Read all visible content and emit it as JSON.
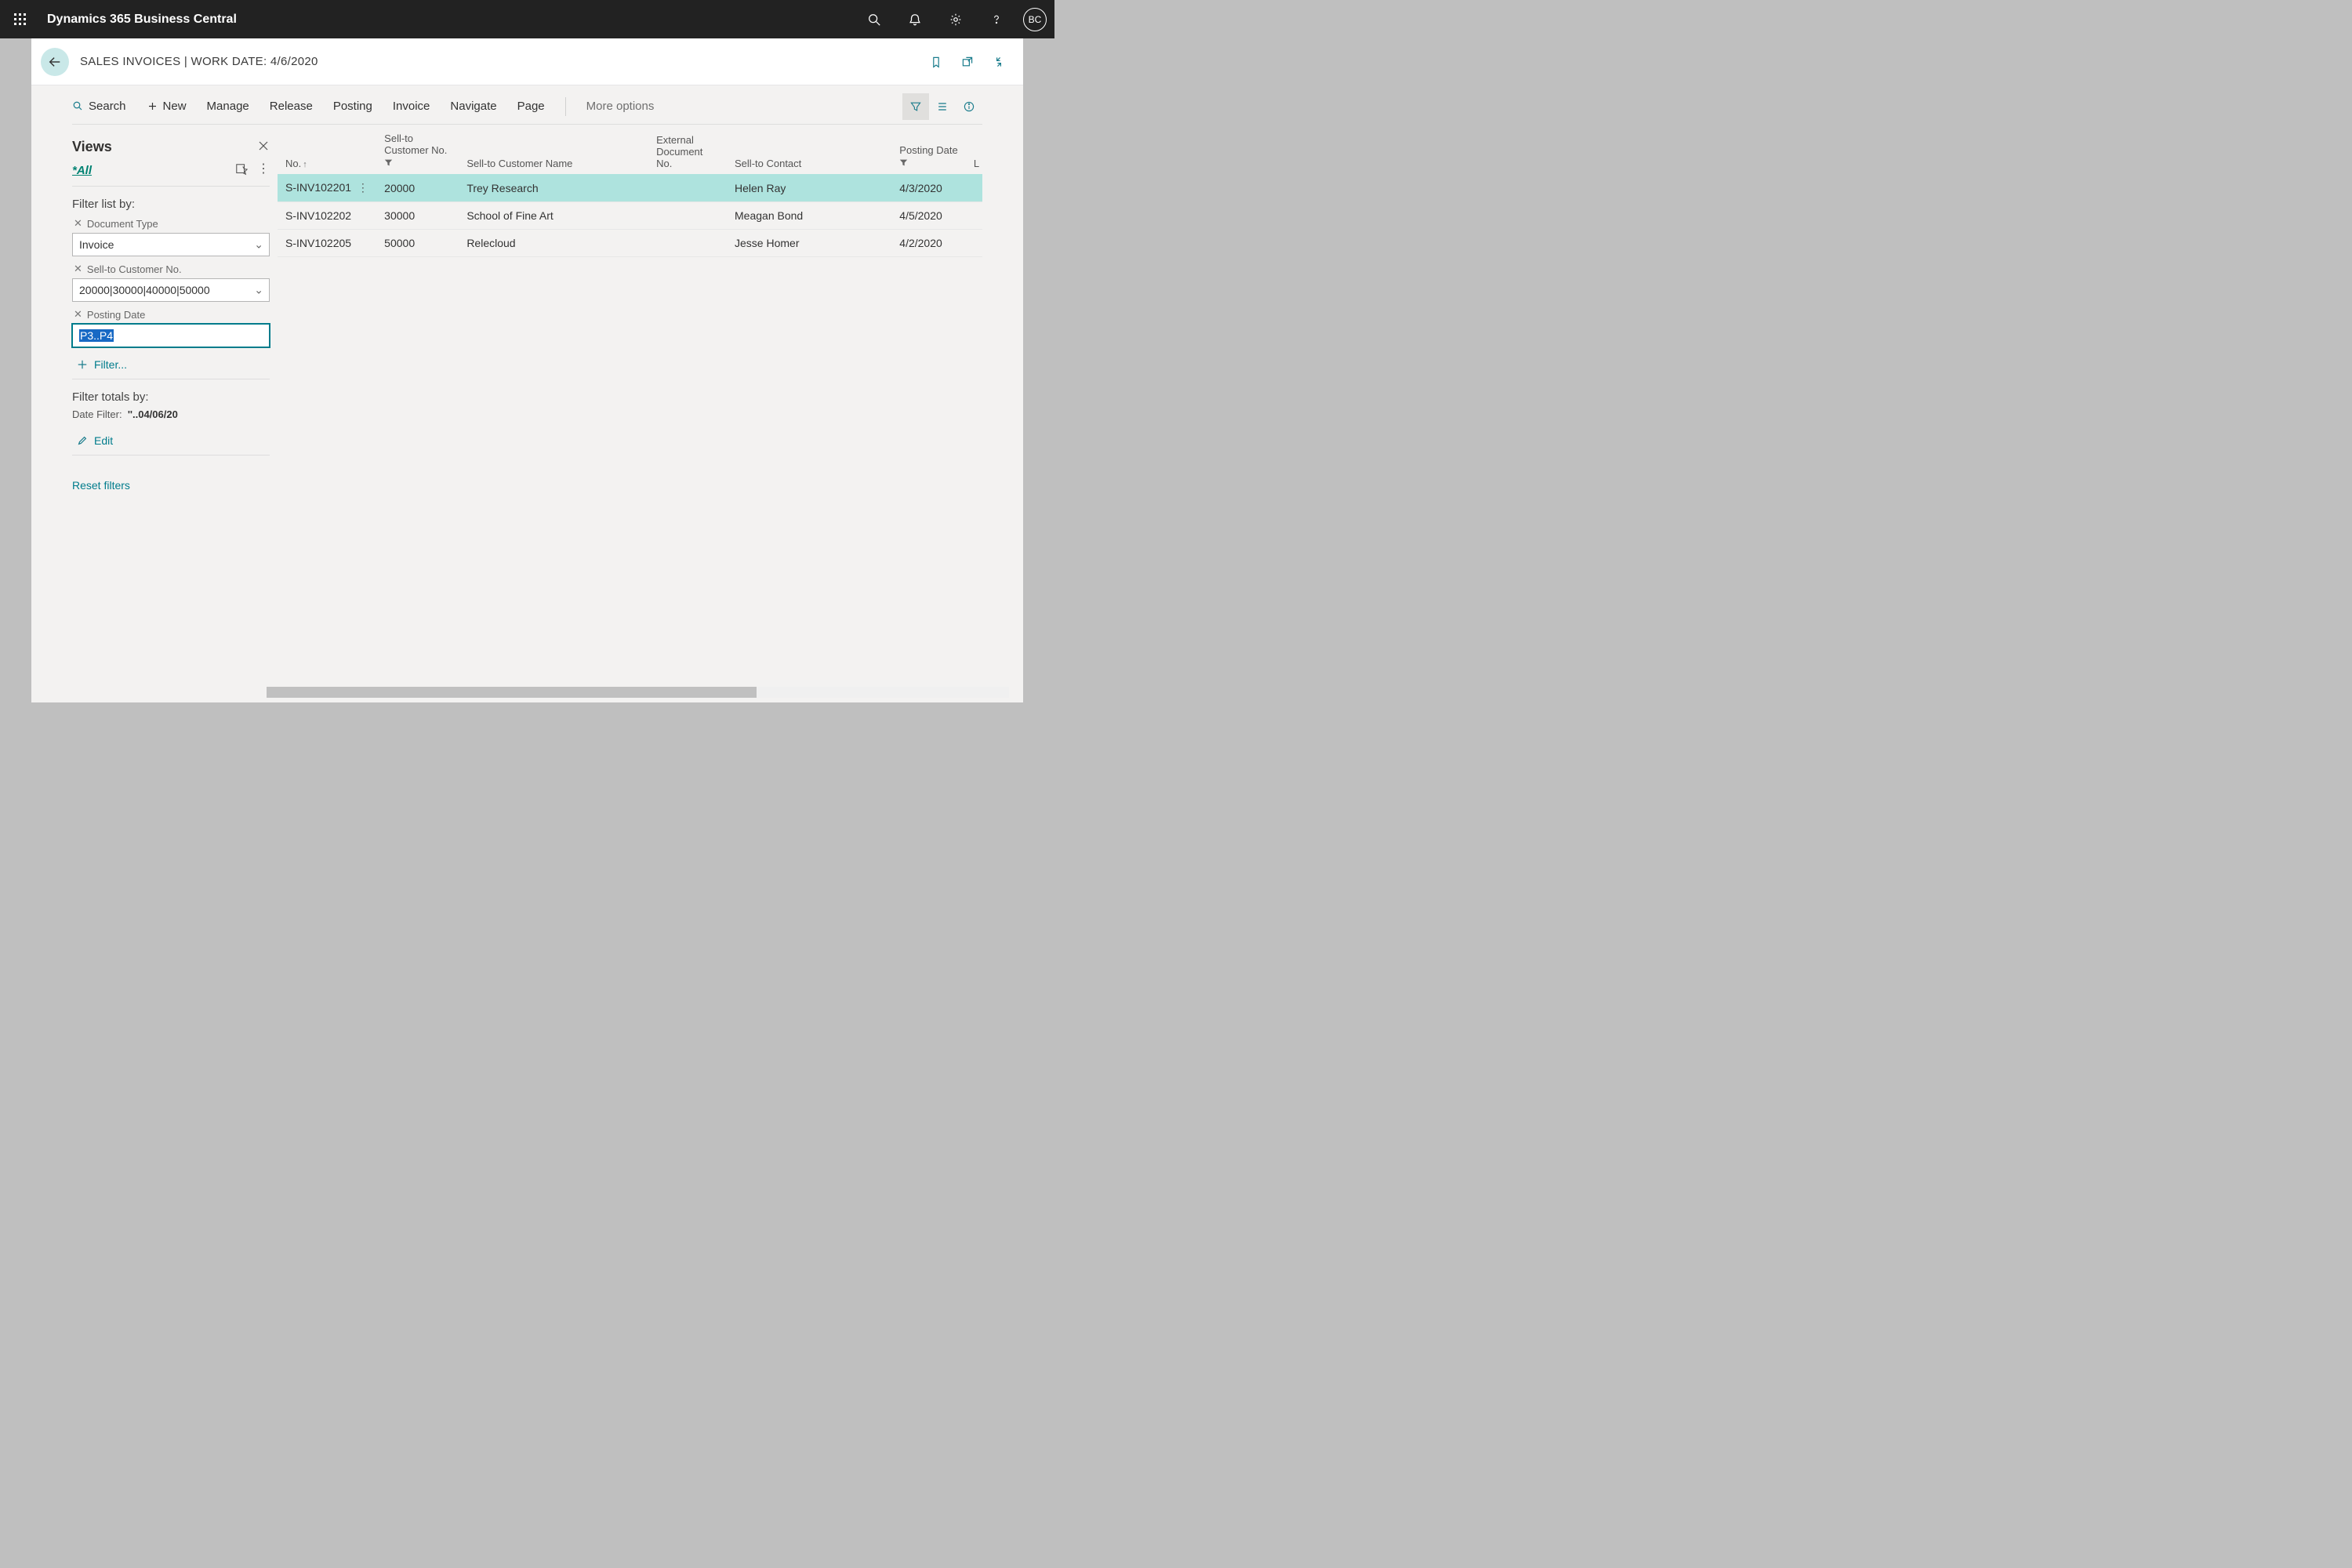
{
  "topbar": {
    "title": "Dynamics 365 Business Central",
    "avatar": "BC"
  },
  "page": {
    "title": "SALES INVOICES | WORK DATE: 4/6/2020"
  },
  "commands": {
    "search": "Search",
    "new": "New",
    "manage": "Manage",
    "release": "Release",
    "posting": "Posting",
    "invoice": "Invoice",
    "navigate": "Navigate",
    "page": "Page",
    "more": "More options"
  },
  "views": {
    "title": "Views",
    "all": "*All",
    "filter_list_label": "Filter list by:",
    "filters": {
      "document_type": {
        "label": "Document Type",
        "value": "Invoice"
      },
      "customer_no": {
        "label": "Sell-to Customer No.",
        "value": "20000|30000|40000|50000"
      },
      "posting_date": {
        "label": "Posting Date",
        "value": "P3..P4"
      }
    },
    "add_filter": "Filter...",
    "totals_label": "Filter totals by:",
    "date_filter_label": "Date Filter:",
    "date_filter_value": "''..04/06/20",
    "edit": "Edit",
    "reset": "Reset filters"
  },
  "table": {
    "headers": {
      "no": "No.",
      "cust_no": "Sell-to Customer No.",
      "cust_name": "Sell-to Customer Name",
      "ext_doc": "External Document No.",
      "contact": "Sell-to Contact",
      "date": "Posting Date",
      "l": "L"
    },
    "rows": [
      {
        "no": "S-INV102201",
        "cust_no": "20000",
        "cust_name": "Trey Research",
        "ext": "",
        "contact": "Helen Ray",
        "date": "4/3/2020",
        "selected": true
      },
      {
        "no": "S-INV102202",
        "cust_no": "30000",
        "cust_name": "School of Fine Art",
        "ext": "",
        "contact": "Meagan Bond",
        "date": "4/5/2020",
        "selected": false
      },
      {
        "no": "S-INV102205",
        "cust_no": "50000",
        "cust_name": "Relecloud",
        "ext": "",
        "contact": "Jesse Homer",
        "date": "4/2/2020",
        "selected": false
      }
    ]
  }
}
